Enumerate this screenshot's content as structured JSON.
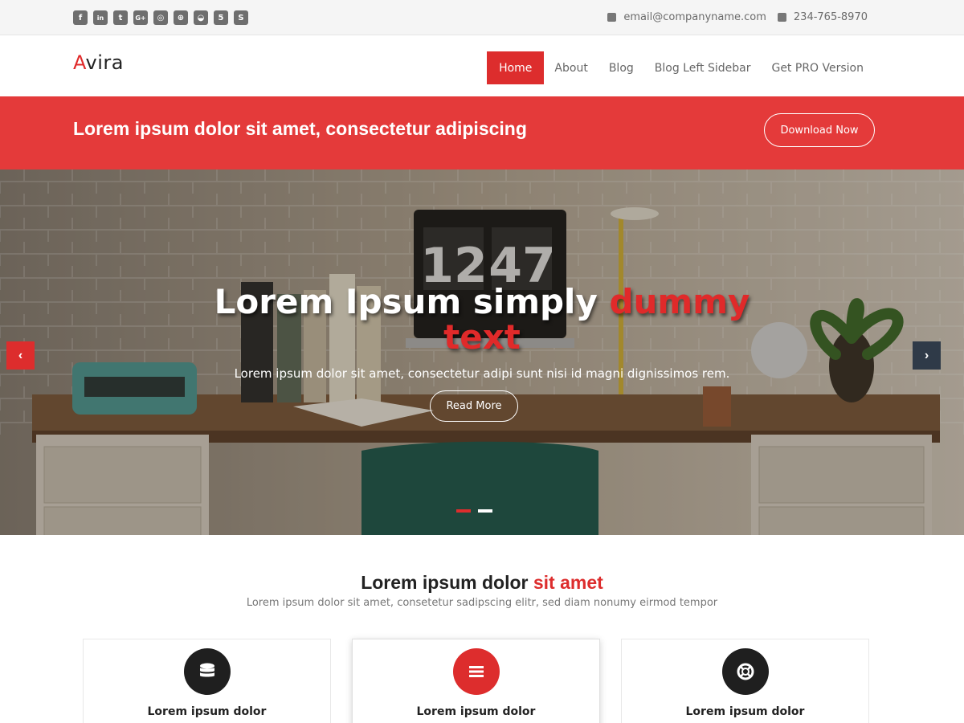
{
  "topbar": {
    "social_icons": [
      {
        "name": "facebook-icon",
        "glyph": "f"
      },
      {
        "name": "linkedin-icon",
        "glyph": "in"
      },
      {
        "name": "twitter-icon",
        "glyph": "t"
      },
      {
        "name": "google-plus-icon",
        "glyph": "G+"
      },
      {
        "name": "instagram-icon",
        "glyph": "◎"
      },
      {
        "name": "dribbble-icon",
        "glyph": "⊕"
      },
      {
        "name": "github-icon",
        "glyph": "◒"
      },
      {
        "name": "html5-icon",
        "glyph": "5"
      },
      {
        "name": "skype-icon",
        "glyph": "S"
      }
    ],
    "email": "email@companyname.com",
    "phone": "234-765-8970"
  },
  "header": {
    "logo_first": "A",
    "logo_rest": "vira",
    "nav": [
      {
        "label": "Home",
        "active": true
      },
      {
        "label": "About",
        "active": false
      },
      {
        "label": "Blog",
        "active": false
      },
      {
        "label": "Blog Left Sidebar",
        "active": false
      },
      {
        "label": "Get PRO Version",
        "active": false
      }
    ]
  },
  "banner": {
    "text": "Lorem ipsum dolor sit amet, consectetur adipiscing",
    "button": "Download Now"
  },
  "hero": {
    "title_main": "Lorem Ipsum simply ",
    "title_highlight_1": "dummy",
    "title_highlight_2": "text",
    "clock_text": "12 47",
    "subtitle": "Lorem ipsum dolor sit amet, consectetur adipi sunt nisi id magni dignissimos rem.",
    "button": "Read More",
    "prev_arrow": "‹",
    "next_arrow": "›",
    "slides": 2,
    "active_slide": 1
  },
  "section": {
    "title_main": "Lorem ipsum dolor ",
    "title_highlight": "sit amet",
    "subtitle": "Lorem ipsum dolor sit amet, consetetur sadipscing elitr, sed diam nonumy eirmod tempor"
  },
  "cards": [
    {
      "icon": "database-icon",
      "title": "Lorem ipsum dolor"
    },
    {
      "icon": "menu-icon",
      "title": "Lorem ipsum dolor"
    },
    {
      "icon": "life-ring-icon",
      "title": "Lorem ipsum dolor"
    }
  ],
  "colors": {
    "accent": "#dd2d2d",
    "banner": "#e43a3a",
    "dark": "#1f1f1f",
    "next_arrow": "#2f3a48"
  }
}
